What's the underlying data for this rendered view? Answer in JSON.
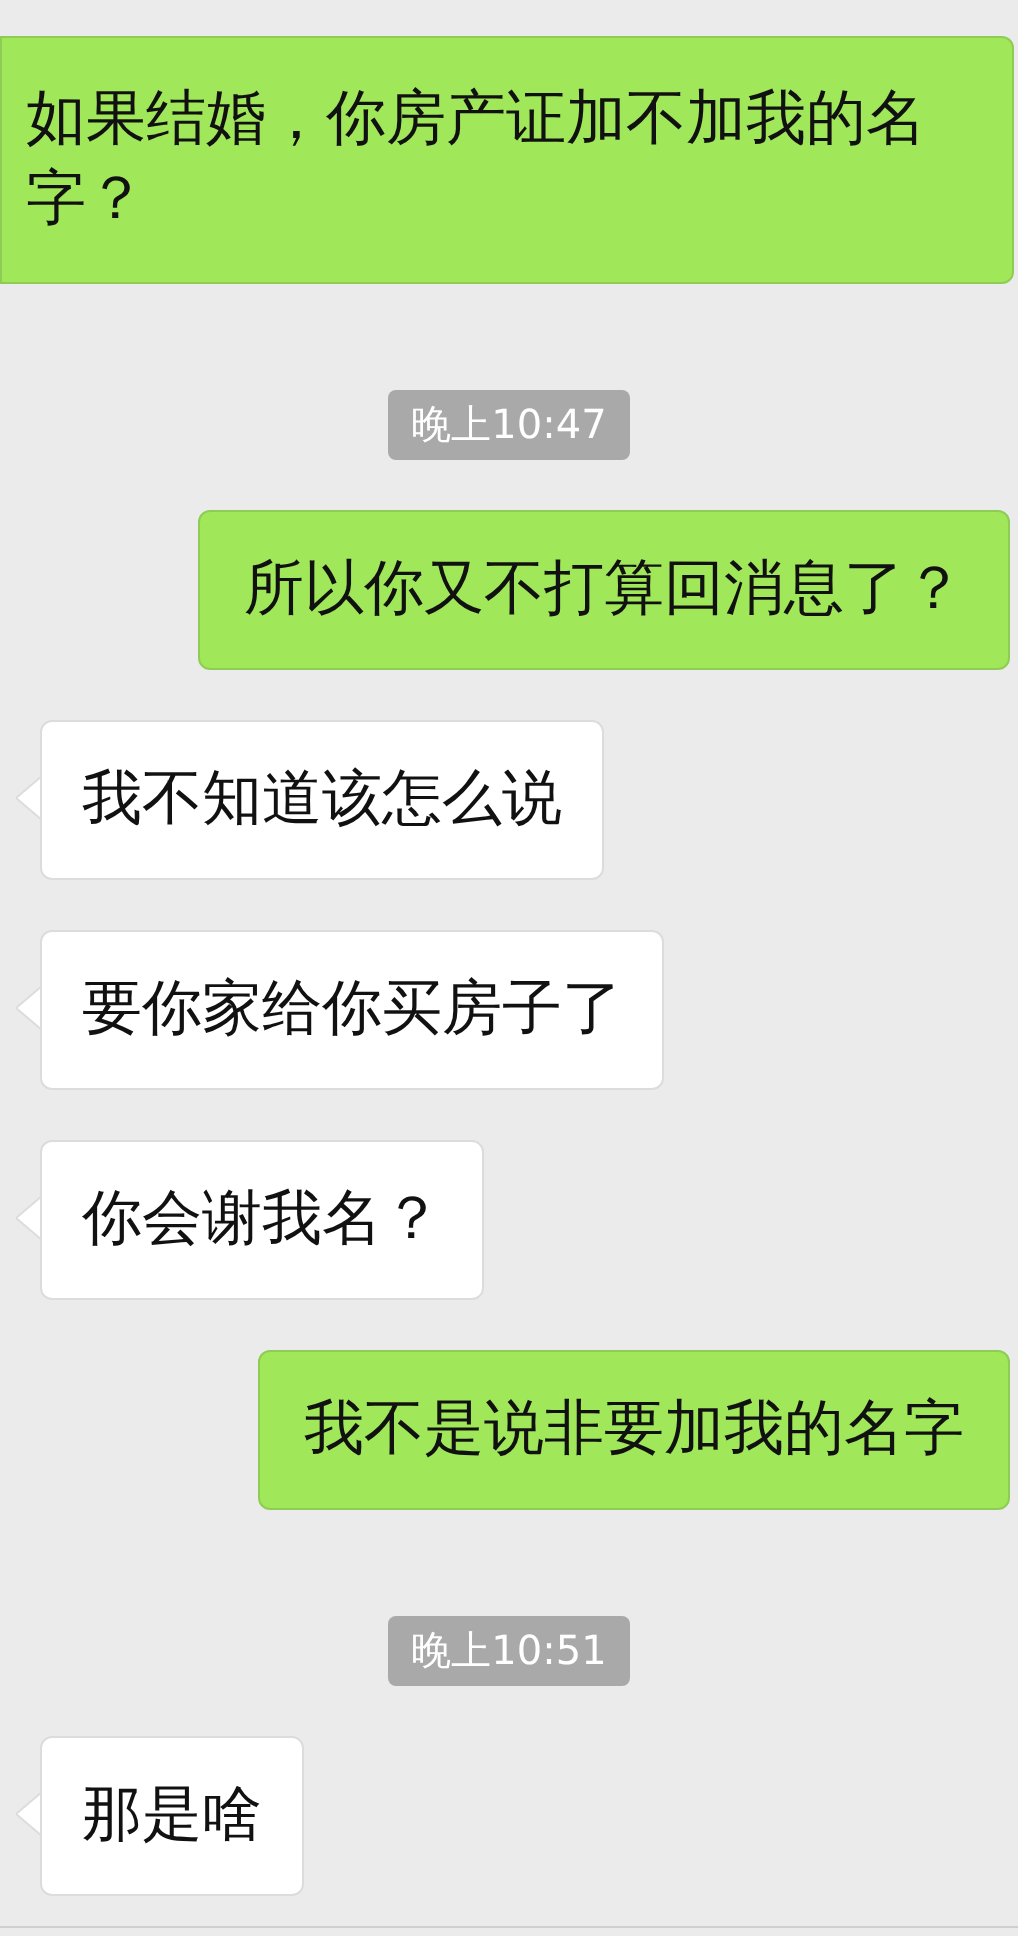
{
  "messages": [
    {
      "kind": "sent",
      "text": "如果结婚，你房产证加不加我的名字？"
    },
    {
      "kind": "time",
      "text": "晚上10:47"
    },
    {
      "kind": "sent",
      "text": "所以你又不打算回消息了？"
    },
    {
      "kind": "received",
      "text": "我不知道该怎么说"
    },
    {
      "kind": "received",
      "text": "要你家给你买房子了"
    },
    {
      "kind": "received",
      "text": "你会谢我名？"
    },
    {
      "kind": "sent",
      "text": "我不是说非要加我的名字"
    },
    {
      "kind": "time",
      "text": "晚上10:51"
    },
    {
      "kind": "received",
      "text": "那是啥"
    }
  ]
}
